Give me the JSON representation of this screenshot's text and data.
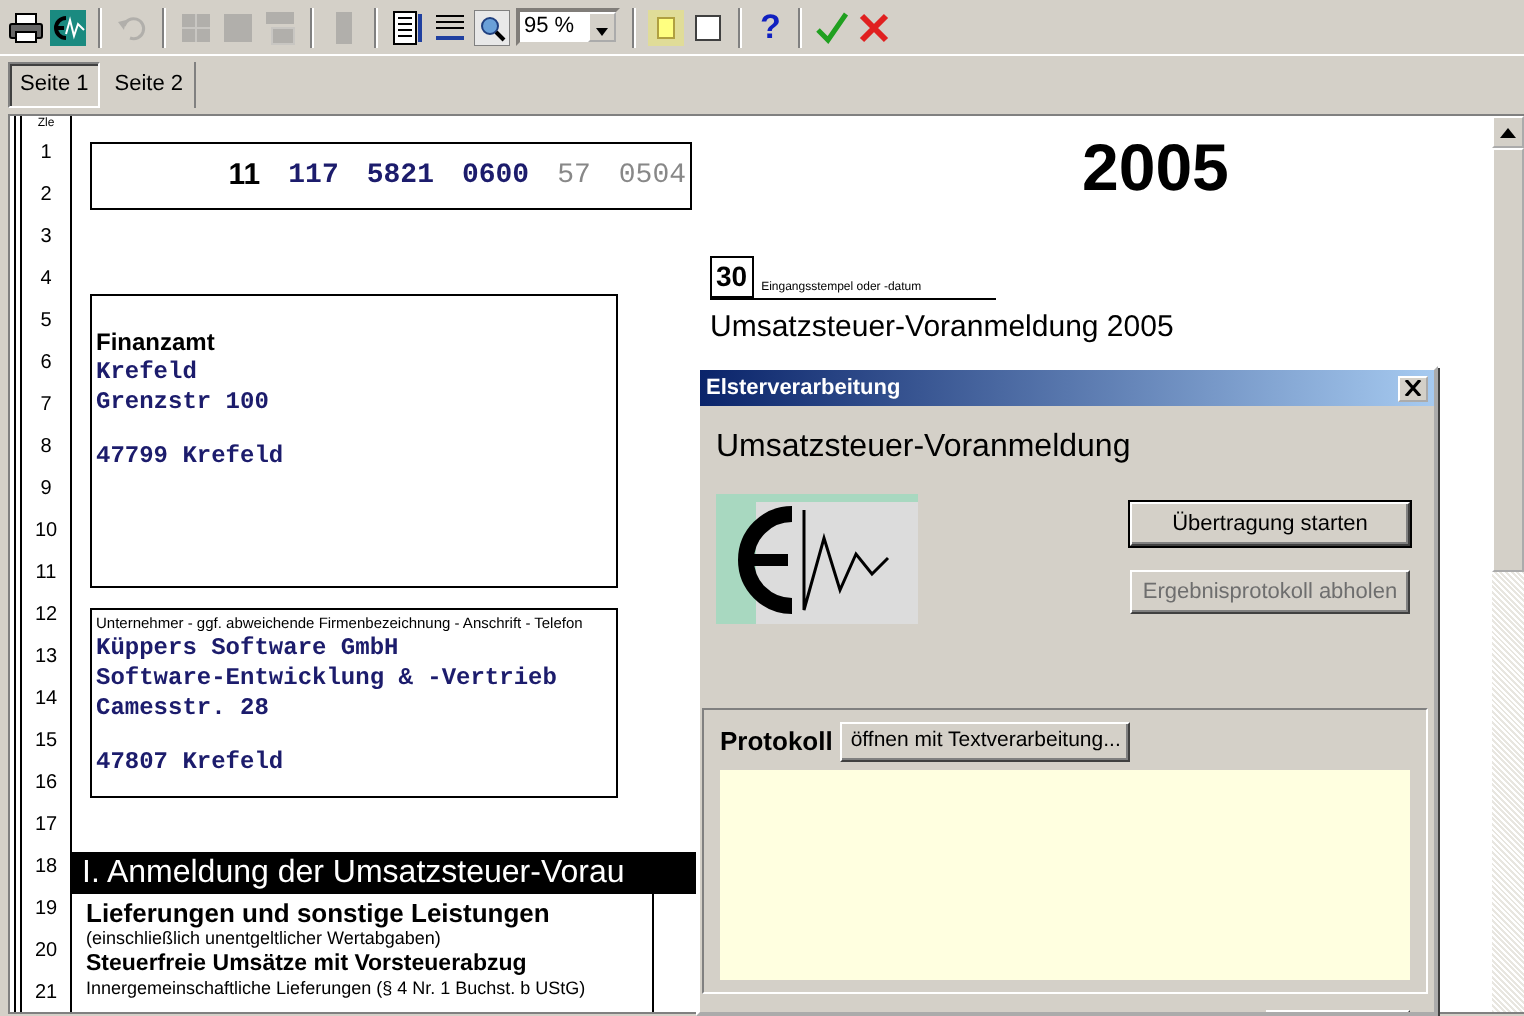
{
  "toolbar": [
    [
      {
        "kind": "printer",
        "disabled": false
      },
      {
        "kind": "elster",
        "disabled": false
      }
    ],
    [
      {
        "kind": "undo",
        "disabled": true
      }
    ],
    [
      {
        "kind": "grid",
        "disabled": true
      },
      {
        "kind": "square",
        "disabled": true
      },
      {
        "kind": "layout",
        "disabled": true
      }
    ],
    [
      {
        "kind": "bar",
        "disabled": true
      }
    ],
    [
      {
        "kind": "lines",
        "disabled": false
      },
      {
        "kind": "spread",
        "disabled": false
      },
      {
        "kind": "magnifier",
        "disabled": false
      },
      {
        "kind": "zoom",
        "value": "95 %"
      }
    ],
    [
      {
        "kind": "panel",
        "disabled": false
      },
      {
        "kind": "frame",
        "disabled": false
      }
    ],
    [
      {
        "kind": "help",
        "disabled": false,
        "glyph": "?"
      }
    ],
    [
      {
        "kind": "check",
        "disabled": false
      },
      {
        "kind": "cancel",
        "disabled": false
      }
    ]
  ],
  "tabs": [
    {
      "label": "Seite 1",
      "selected": true
    },
    {
      "label": "Seite 2",
      "selected": false
    }
  ],
  "form": {
    "line_header": "Zle",
    "line_numbers": [
      "1",
      "2",
      "3",
      "4",
      "5",
      "6",
      "7",
      "8",
      "9",
      "10",
      "11",
      "12",
      "13",
      "14",
      "15",
      "16",
      "17",
      "18",
      "19",
      "20",
      "21"
    ],
    "tax_number": [
      {
        "text": "11",
        "kind": "prefix"
      },
      {
        "text": "117",
        "kind": "number"
      },
      {
        "text": "5821",
        "kind": "number"
      },
      {
        "text": "0600",
        "kind": "number"
      },
      {
        "text": "57",
        "kind": "code"
      },
      {
        "text": "0504",
        "kind": "code"
      }
    ],
    "year": "2005",
    "receipt_field": {
      "number": "30",
      "caption": "Eingangsstempel oder -datum"
    },
    "title": "Umsatzsteuer-Voranmeldung 2005",
    "tax_office": {
      "heading": "Finanzamt",
      "blocks": [
        [
          "Krefeld",
          "Grenzstr 100"
        ],
        [
          "47799 Krefeld"
        ]
      ]
    },
    "company": {
      "caption": "Unternehmer - ggf. abweichende Firmenbezeichnung - Anschrift - Telefon",
      "blocks": [
        [
          "Küppers Software GmbH",
          "Software-Entwicklung & -Vertrieb",
          "Camesstr. 28"
        ],
        [
          "47807 Krefeld"
        ]
      ]
    },
    "section": {
      "heading": "I. Anmeldung der Umsatzsteuer-Vorau",
      "items": [
        {
          "kind": "heading",
          "text": "Lieferungen und sonstige Leistungen"
        },
        {
          "kind": "note",
          "text": "(einschließlich unentgeltlicher Wertabgaben)"
        },
        {
          "kind": "subheading",
          "text": "Steuerfreie Umsätze mit Vorsteuerabzug"
        },
        {
          "kind": "note",
          "text": "Innergemeinschaftliche Lieferungen (§ 4 Nr. 1 Buchst. b UStG)"
        }
      ]
    }
  },
  "dialog": {
    "title": "Elsterverarbeitung",
    "heading": "Umsatzsteuer-Voranmeldung",
    "buttons": [
      {
        "label": "Übertragung starten",
        "disabled": false,
        "default": true
      },
      {
        "label": "Ergebnisprotokoll abholen",
        "disabled": true,
        "default": false
      }
    ],
    "protocol": {
      "label": "Protokoll",
      "button": "öffnen mit Textverarbeitung..."
    }
  }
}
